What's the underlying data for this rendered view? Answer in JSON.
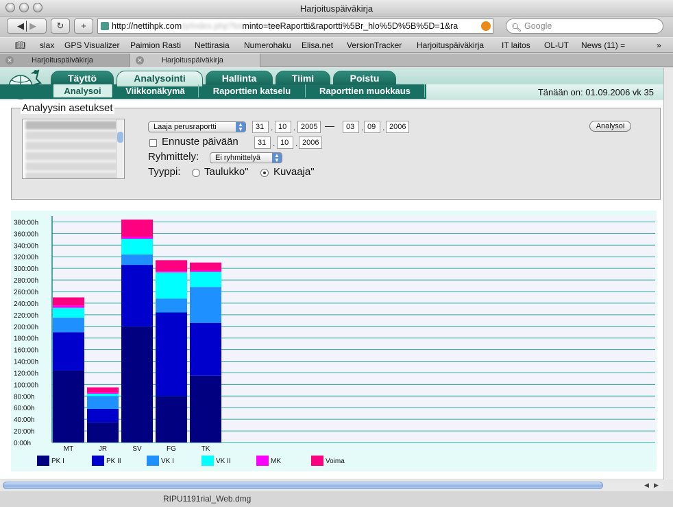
{
  "window": {
    "title": "Harjoituspäiväkirja"
  },
  "toolbar": {
    "url_prefix": "http://nettihpk.com",
    "url_obscured": "/p/index.php?toi",
    "url_suffix": "minto=teeRaportti&raportti%5Br_hlo%5D%5B%5D=1&ra",
    "search_placeholder": "Google"
  },
  "bookmarks": [
    "slax",
    "GPS Visualizer",
    "Paimion Rasti",
    "Nettirasia",
    "Numerohaku",
    "Elisa.net",
    "VersionTracker",
    "Harjoituspäiväkirja",
    "IT laitos",
    "OL-UT",
    "News (11) ="
  ],
  "browser_tabs": [
    {
      "label": "Harjoituspäiväkirja",
      "active": false
    },
    {
      "label": "Harjoituspäiväkirja",
      "active": true
    }
  ],
  "app": {
    "main_tabs": [
      "Täyttö",
      "Analysointi",
      "Hallinta",
      "Tiimi",
      "Poistu"
    ],
    "selected_main_tab": "Analysointi",
    "sub_tabs": [
      "Analysoi",
      "Viikkonäkymä",
      "Raporttien katselu",
      "Raporttien muokkaus"
    ],
    "selected_sub_tab": "Analysoi",
    "today": "Tänään on: 01.09.2006 vk 35"
  },
  "settings": {
    "legend": "Analyysin asetukset",
    "report_type": "Laaja perusraportti",
    "start": {
      "d": "31",
      "m": "10",
      "y": "2005"
    },
    "dash": "—",
    "end": {
      "d": "03",
      "m": "09",
      "y": "2006"
    },
    "forecast_label": "Ennuste päivään",
    "forecast": {
      "d": "31",
      "m": "10",
      "y": "2006"
    },
    "forecast_checked": false,
    "grouping_label": "Ryhmittely:",
    "grouping_value": "Ei ryhmittelyä",
    "type_label": "Tyyppi:",
    "type_options": [
      "Taulukko\"",
      "Kuvaaja\""
    ],
    "type_selected": "Kuvaaja\"",
    "analyze_button": "Analysoi",
    "date_separator": "."
  },
  "chart_data": {
    "type": "bar",
    "stacked": true,
    "categories": [
      "MT",
      "JR",
      "SV",
      "FG",
      "TK"
    ],
    "series": [
      {
        "name": "PK I",
        "color": "#000080",
        "values": [
          124,
          35,
          200,
          80,
          115
        ]
      },
      {
        "name": "PK II",
        "color": "#0000CD",
        "values": [
          66,
          23,
          106,
          144,
          91
        ]
      },
      {
        "name": "VK I",
        "color": "#1E90FF",
        "values": [
          25,
          22,
          18,
          24,
          62
        ]
      },
      {
        "name": "VK II",
        "color": "#00FFFF",
        "values": [
          17,
          4,
          27,
          45,
          26
        ]
      },
      {
        "name": "MK",
        "color": "#FF00FF",
        "values": [
          4,
          2,
          3,
          2,
          2
        ]
      },
      {
        "name": "Voima",
        "color": "#FF0080",
        "values": [
          14,
          9,
          30,
          19,
          14
        ]
      }
    ],
    "y_ticks": [
      "0:00h",
      "20:00h",
      "40:00h",
      "60:00h",
      "80:00h",
      "100:00h",
      "120:00h",
      "140:00h",
      "160:00h",
      "180:00h",
      "200:00h",
      "220:00h",
      "240:00h",
      "260:00h",
      "280:00h",
      "300:00h",
      "320:00h",
      "340:00h",
      "360:00h",
      "380:00h"
    ],
    "ylim": [
      0,
      390
    ],
    "grid": true,
    "legend_position": "bottom"
  }
}
